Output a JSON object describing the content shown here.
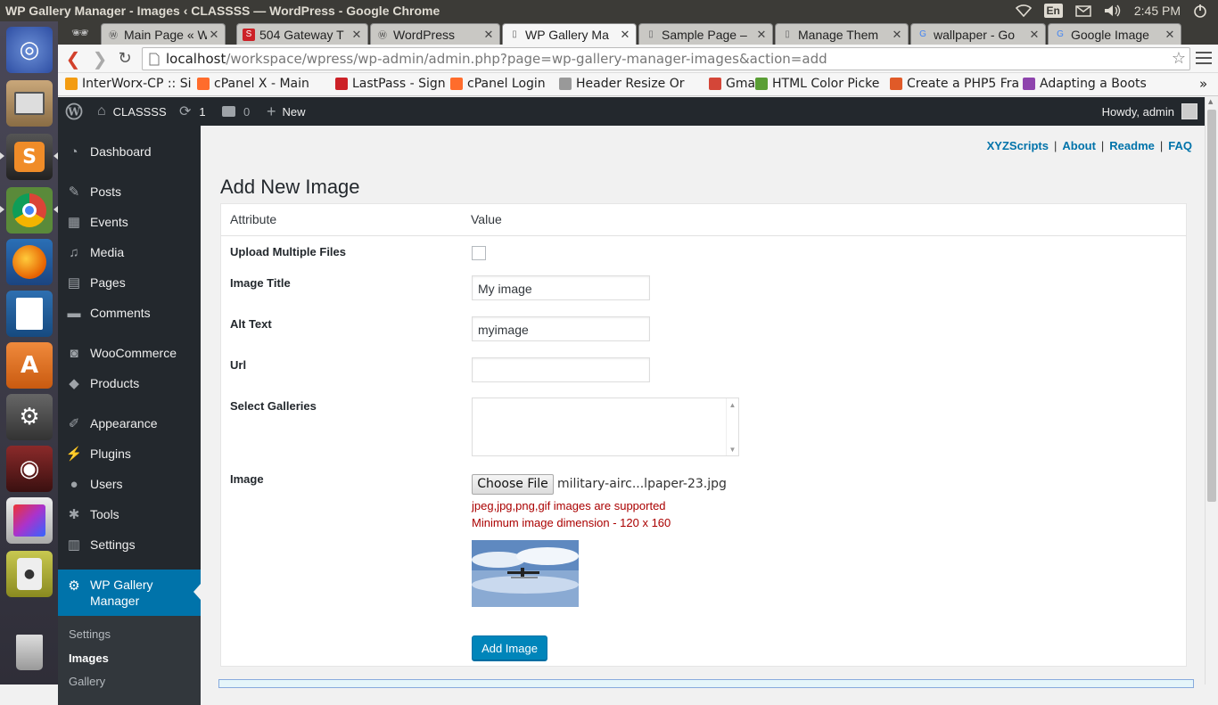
{
  "os": {
    "window_title": "WP Gallery Manager - Images ‹ CLASSSS — WordPress - Google Chrome",
    "lang": "En",
    "time": "2:45 PM"
  },
  "browser": {
    "tabs": [
      {
        "title": "Main Page « W",
        "icon": "wp"
      },
      {
        "title": "504 Gateway T",
        "icon": "s"
      },
      {
        "title": "WordPress",
        "icon": "wp"
      },
      {
        "title": "WP Gallery Ma",
        "icon": "doc",
        "active": true
      },
      {
        "title": "Sample Page –",
        "icon": "doc"
      },
      {
        "title": "Manage Them",
        "icon": "doc"
      },
      {
        "title": "wallpaper - Go",
        "icon": "g"
      },
      {
        "title": "Google Image",
        "icon": "g"
      }
    ],
    "url_host": "localhost",
    "url_path": "/workspace/wpress/wp-admin/admin.php?page=wp-gallery-manager-images&action=add",
    "bookmarks": [
      {
        "label": "InterWorx-CP :: Si",
        "color": "#f39c12"
      },
      {
        "label": "cPanel X - Main",
        "color": "#ff6c2c"
      },
      {
        "label": "LastPass - Sign In",
        "color": "#cc2127"
      },
      {
        "label": "cPanel Login",
        "color": "#ff6c2c"
      },
      {
        "label": "Header Resize Or",
        "color": "#999999"
      },
      {
        "label": "Gmail",
        "color": "#d44638"
      },
      {
        "label": "HTML Color Picke",
        "color": "#5a9e35"
      },
      {
        "label": "Create a PHP5 Fra",
        "color": "#e05a28"
      },
      {
        "label": "Adapting a Boots",
        "color": "#8e44ad"
      }
    ],
    "more": "»"
  },
  "adminbar": {
    "site": "CLASSSS",
    "updates": "1",
    "comments": "0",
    "new": "New",
    "howdy": "Howdy, admin"
  },
  "sidebar": {
    "items": [
      {
        "label": "Dashboard",
        "icon": "dashboard-icon"
      },
      {
        "label": "Posts",
        "icon": "pin-icon"
      },
      {
        "label": "Events",
        "icon": "calendar-icon"
      },
      {
        "label": "Media",
        "icon": "media-icon"
      },
      {
        "label": "Pages",
        "icon": "pages-icon"
      },
      {
        "label": "Comments",
        "icon": "comment-icon"
      },
      {
        "label": "WooCommerce",
        "icon": "woo-icon"
      },
      {
        "label": "Products",
        "icon": "box-icon"
      },
      {
        "label": "Appearance",
        "icon": "brush-icon"
      },
      {
        "label": "Plugins",
        "icon": "plug-icon"
      },
      {
        "label": "Users",
        "icon": "user-icon"
      },
      {
        "label": "Tools",
        "icon": "wrench-icon"
      },
      {
        "label": "Settings",
        "icon": "settings-icon"
      }
    ],
    "current": {
      "label_line1": "WP Gallery",
      "label_line2": "Manager",
      "icon": "gear-icon"
    },
    "submenu": [
      "Settings",
      "Images",
      "Gallery"
    ]
  },
  "content": {
    "toplinks": [
      "XYZScripts",
      "About",
      "Readme",
      "FAQ"
    ],
    "heading": "Add New Image",
    "table": {
      "col_attribute": "Attribute",
      "col_value": "Value"
    },
    "fields": {
      "upload_multiple": "Upload Multiple Files",
      "image_title_label": "Image Title",
      "image_title_value": "My image",
      "alt_text_label": "Alt Text",
      "alt_text_value": "myimage",
      "url_label": "Url",
      "url_value": "",
      "galleries_label": "Select Galleries",
      "image_label": "Image",
      "choose_file": "Choose File",
      "file_name": "military-airc...lpaper-23.jpg",
      "note_types": "jpeg,jpg,png,gif images are supported",
      "note_dimension": "Minimum image dimension - 120 x 160"
    },
    "submit": "Add Image"
  }
}
